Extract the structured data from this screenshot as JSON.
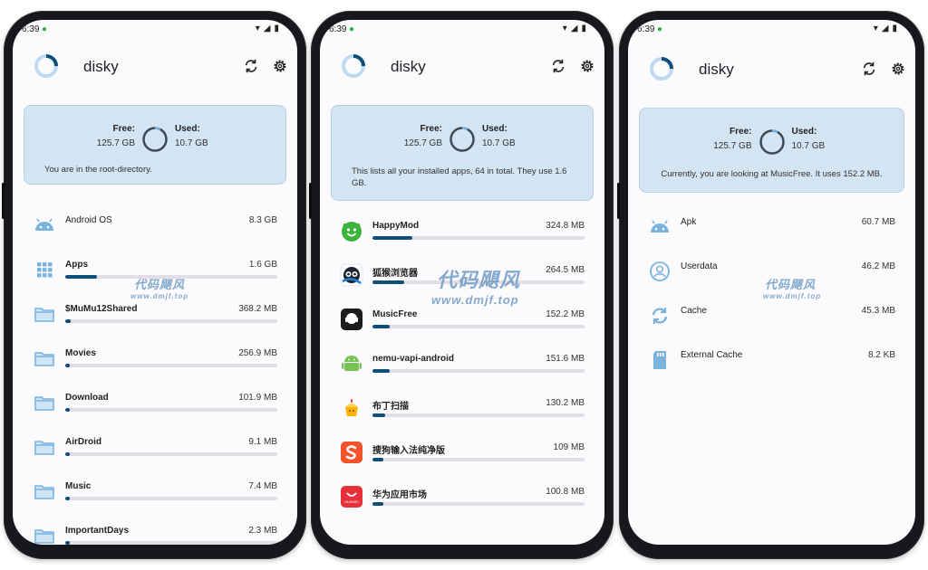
{
  "watermark": {
    "text": "代码飓风",
    "url": "www.dmjf.top"
  },
  "screens": [
    {
      "status_time": "6:39",
      "app_title": "disky",
      "summary": {
        "free_label": "Free:",
        "free_value": "125.7 GB",
        "used_label": "Used:",
        "used_value": "10.7 GB",
        "used_fraction": 0.078,
        "description": "You are in the root-directory."
      },
      "items": [
        {
          "name": "Android OS",
          "size": "8.3 GB",
          "icon": "android-icon",
          "bold": false,
          "bar": null
        },
        {
          "name": "Apps",
          "size": "1.6 GB",
          "icon": "apps-grid-icon",
          "bold": true,
          "bar": 0.15
        },
        {
          "name": "$MuMu12Shared",
          "size": "368.2 MB",
          "icon": "folder-icon",
          "bold": true,
          "bar": 0.025
        },
        {
          "name": "Movies",
          "size": "256.9 MB",
          "icon": "folder-icon",
          "bold": true,
          "bar": 0.018
        },
        {
          "name": "Download",
          "size": "101.9 MB",
          "icon": "folder-icon",
          "bold": true,
          "bar": 0.01
        },
        {
          "name": "AirDroid",
          "size": "9.1 MB",
          "icon": "folder-icon",
          "bold": true,
          "bar": 0.0
        },
        {
          "name": "Music",
          "size": "7.4 MB",
          "icon": "folder-icon",
          "bold": true,
          "bar": 0.0
        },
        {
          "name": "ImportantDays",
          "size": "2.3 MB",
          "icon": "folder-icon",
          "bold": true,
          "bar": 0.0
        }
      ]
    },
    {
      "status_time": "6:39",
      "app_title": "disky",
      "summary": {
        "free_label": "Free:",
        "free_value": "125.7 GB",
        "used_label": "Used:",
        "used_value": "10.7 GB",
        "used_fraction": 0.078,
        "description": "This lists all your installed apps, 64 in total. They use 1.6 GB."
      },
      "items": [
        {
          "name": "HappyMod",
          "size": "324.8 MB",
          "icon": "happymod-app-icon",
          "bold": true,
          "bar": 0.19
        },
        {
          "name": "狐猴浏览器",
          "size": "264.5 MB",
          "icon": "lemur-browser-app-icon",
          "bold": true,
          "bar": 0.15
        },
        {
          "name": "MusicFree",
          "size": "152.2 MB",
          "icon": "musicfree-app-icon",
          "bold": true,
          "bar": 0.08
        },
        {
          "name": "nemu-vapi-android",
          "size": "151.6 MB",
          "icon": "android-app-icon",
          "bold": true,
          "bar": 0.08
        },
        {
          "name": "布丁扫描",
          "size": "130.2 MB",
          "icon": "pudding-scan-app-icon",
          "bold": true,
          "bar": 0.06
        },
        {
          "name": "搜狗输入法纯净版",
          "size": "109 MB",
          "icon": "sogou-input-app-icon",
          "bold": true,
          "bar": 0.05
        },
        {
          "name": "华为应用市场",
          "size": "100.8 MB",
          "icon": "huawei-appgallery-icon",
          "bold": true,
          "bar": 0.05
        }
      ]
    },
    {
      "status_time": "6:39",
      "app_title": "disky",
      "summary": {
        "free_label": "Free:",
        "free_value": "125.7 GB",
        "used_label": "Used:",
        "used_value": "10.7 GB",
        "used_fraction": 0.078,
        "description": "Currently, you are looking at MusicFree. It uses 152.2 MB."
      },
      "items": [
        {
          "name": "Apk",
          "size": "60.7 MB",
          "icon": "android-icon",
          "bold": false,
          "bar": null
        },
        {
          "name": "Userdata",
          "size": "46.2 MB",
          "icon": "user-icon",
          "bold": false,
          "bar": null
        },
        {
          "name": "Cache",
          "size": "45.3 MB",
          "icon": "cache-sync-icon",
          "bold": false,
          "bar": null
        },
        {
          "name": "External Cache",
          "size": "8.2 KB",
          "icon": "sd-card-icon",
          "bold": false,
          "bar": null
        }
      ]
    }
  ],
  "colors": {
    "accent": "#0f4e78",
    "card": "#d3e4f2",
    "icon_blue": "#7ab3de"
  }
}
